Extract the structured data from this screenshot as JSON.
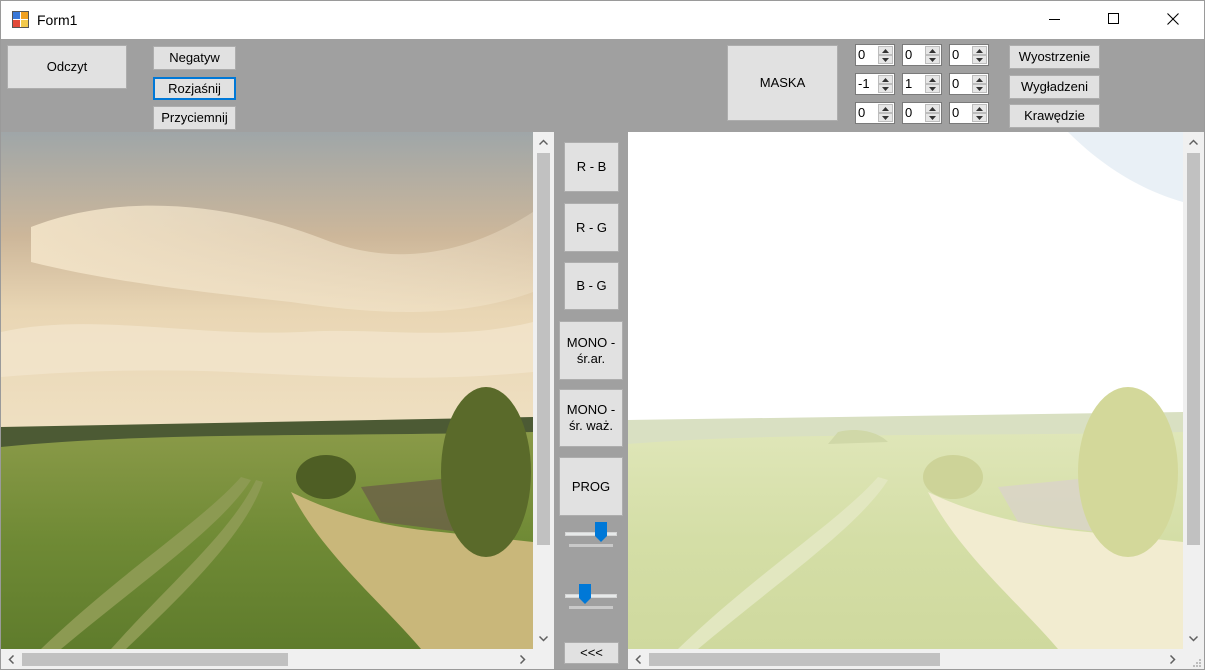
{
  "window": {
    "title": "Form1",
    "controls": {
      "minimize": "minimize-icon",
      "maximize": "maximize-icon",
      "close": "close-icon"
    }
  },
  "toolbar": {
    "read_label": "Odczyt",
    "negative_label": "Negatyw",
    "brighten_label": "Rozjaśnij",
    "darken_label": "Przyciemnij",
    "mask_label": "MASKA",
    "sharpen_label": "Wyostrzenie",
    "smooth_label": "Wygładzeni",
    "edges_label": "Krawędzie"
  },
  "mask": {
    "values": [
      [
        "0",
        "0",
        "0"
      ],
      [
        "-1",
        "1",
        "0"
      ],
      [
        "0",
        "0",
        "0"
      ]
    ]
  },
  "middle": {
    "rb_label": "R - B",
    "rg_label": "R - G",
    "bg_label": "B - G",
    "mono_avg_label": "MONO - śr.ar.",
    "mono_weighted_label": "MONO - śr. waż.",
    "threshold_label": "PROG",
    "back_label": "<<<"
  },
  "sliders": {
    "threshold_fraction": 0.75,
    "second_fraction": 0.35
  },
  "colors": {
    "form_background": "#a0a0a0",
    "button_face": "#e1e1e1",
    "focus_border": "#0078d7",
    "slider_thumb": "#0078d7"
  }
}
